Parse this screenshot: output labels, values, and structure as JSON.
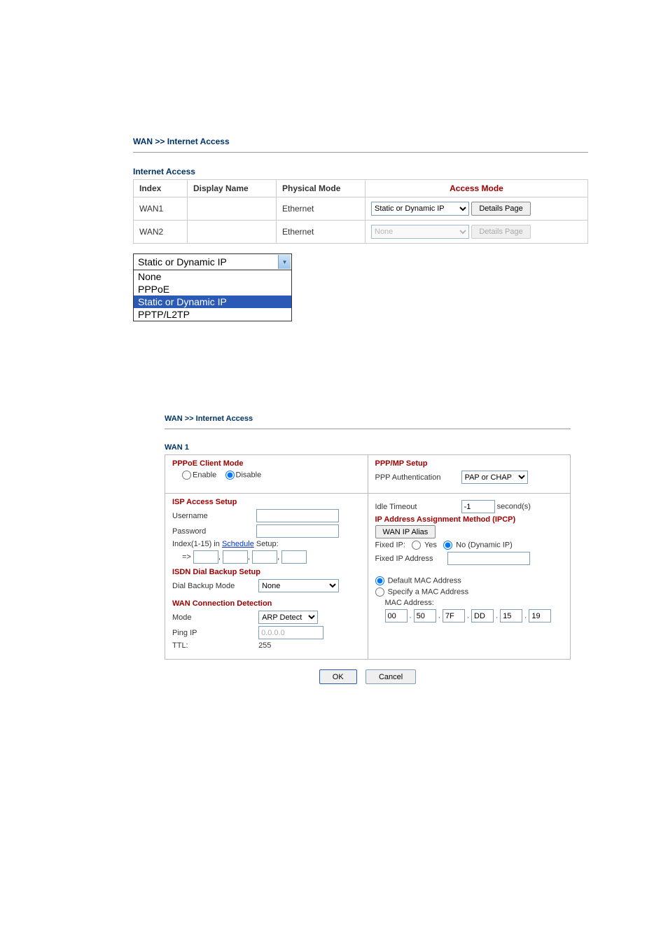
{
  "breadcrumb1": {
    "a": "WAN",
    "sep": " >> ",
    "b": "Internet Access"
  },
  "internet_access": {
    "title": "Internet Access",
    "cols": {
      "index": "Index",
      "display": "Display Name",
      "phys": "Physical Mode",
      "access": "Access Mode"
    },
    "rows": [
      {
        "idx": "WAN1",
        "display": "",
        "phys": "Ethernet",
        "mode": "Static or Dynamic IP",
        "details": "Details Page",
        "enabled": true
      },
      {
        "idx": "WAN2",
        "display": "",
        "phys": "Ethernet",
        "mode": "None",
        "details": "Details Page",
        "enabled": false
      }
    ]
  },
  "dropdown": {
    "top": "Static or Dynamic IP",
    "opts": [
      "None",
      "PPPoE",
      "Static or Dynamic IP",
      "PPTP/L2TP"
    ],
    "selectedIndex": 2
  },
  "breadcrumb2": {
    "a": "WAN",
    "sep": " >> ",
    "b": "Internet Access"
  },
  "wan1": {
    "title": "WAN 1",
    "pppoe": {
      "title": "PPPoE Client Mode",
      "enable": "Enable",
      "disable": "Disable"
    },
    "isp": {
      "title": "ISP Access Setup",
      "user": "Username",
      "pass": "Password",
      "scheduleLineA": "Index(1-15) in ",
      "scheduleLink": "Schedule",
      "scheduleLineB": " Setup:",
      "arrow": "=>"
    },
    "isdn": {
      "title": "ISDN Dial Backup Setup",
      "mode": "Dial Backup Mode",
      "modeVal": "None"
    },
    "det": {
      "title": "WAN Connection Detection",
      "mode": "Mode",
      "modeVal": "ARP Detect",
      "ping": "Ping IP",
      "pingVal": "0.0.0.0",
      "ttl": "TTL:",
      "ttlVal": "255"
    },
    "ppp": {
      "title": "PPP/MP Setup",
      "auth": "PPP Authentication",
      "authVal": "PAP or CHAP",
      "idle": "Idle Timeout",
      "idleVal": "-1",
      "idleUnit": "second(s)"
    },
    "ipa": {
      "title": "IP Address Assignment Method (IPCP)",
      "btn": "WAN IP Alias",
      "fixed": "Fixed IP:",
      "yes": "Yes",
      "no": "No (Dynamic IP)",
      "addr": "Fixed IP Address"
    },
    "mac": {
      "def": "Default MAC Address",
      "spec": "Specify a MAC Address",
      "lbl": "MAC Address:",
      "v": [
        "00",
        "50",
        "7F",
        "DD",
        "15",
        "19"
      ]
    },
    "buttons": {
      "ok": "OK",
      "cancel": "Cancel"
    }
  }
}
